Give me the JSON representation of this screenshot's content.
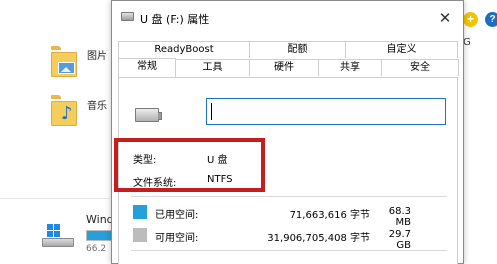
{
  "explorer": {
    "items": [
      {
        "label": "图片"
      },
      {
        "label": "音乐"
      }
    ],
    "drive": {
      "name": "Wind",
      "size": "66.2"
    },
    "edge_text": "G",
    "help_glyph": "+",
    "help2_glyph": "?"
  },
  "dialog": {
    "title": "U 盘 (F:) 属性",
    "close_glyph": "✕",
    "tabs_row1": [
      "ReadyBoost",
      "配额",
      "自定义"
    ],
    "tabs_row2": [
      "常规",
      "工具",
      "硬件",
      "共享",
      "安全"
    ],
    "active_tab": "常规",
    "name_value": "",
    "type_label": "类型:",
    "type_value": "U 盘",
    "fs_label": "文件系统:",
    "fs_value": "NTFS",
    "used": {
      "label": "已用空间:",
      "bytes": "71,663,616 字节",
      "human": "68.3 MB"
    },
    "free": {
      "label": "可用空间:",
      "bytes": "31,906,705,408 字节",
      "human": "29.7 GB"
    }
  },
  "colors": {
    "used": "#26a0da",
    "free": "#bcbcbc",
    "highlight": "#c41f1f",
    "input_focus": "#1a73c8"
  }
}
